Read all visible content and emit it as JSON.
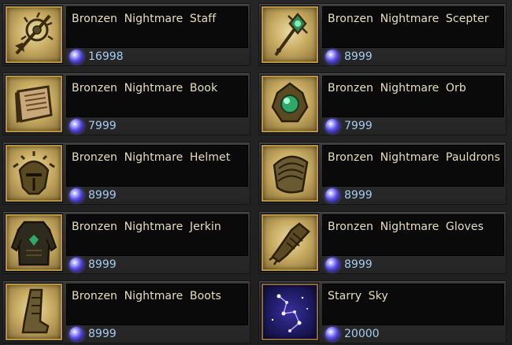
{
  "currency": {
    "icon": "purple-gem-icon",
    "color": "#5b50e0"
  },
  "colors": {
    "name_text": "#e7dfbf",
    "price_text": "#a6ccf2",
    "icon_frame": "#b8953a"
  },
  "items": [
    {
      "name": "Bronzen Nightmare Staff",
      "price": "16998",
      "icon": "staff-icon"
    },
    {
      "name": "Bronzen Nightmare Scepter",
      "price": "8999",
      "icon": "scepter-icon"
    },
    {
      "name": "Bronzen Nightmare Book",
      "price": "7999",
      "icon": "book-icon"
    },
    {
      "name": "Bronzen Nightmare Orb",
      "price": "7999",
      "icon": "orb-icon"
    },
    {
      "name": "Bronzen Nightmare Helmet",
      "price": "8999",
      "icon": "helmet-icon"
    },
    {
      "name": "Bronzen Nightmare Pauldrons",
      "price": "8999",
      "icon": "pauldrons-icon"
    },
    {
      "name": "Bronzen Nightmare Jerkin",
      "price": "8999",
      "icon": "jerkin-icon"
    },
    {
      "name": "Bronzen Nightmare Gloves",
      "price": "8999",
      "icon": "gloves-icon"
    },
    {
      "name": "Bronzen Nightmare Boots",
      "price": "8999",
      "icon": "boots-icon"
    },
    {
      "name": "Starry Sky",
      "price": "20000",
      "icon": "starry-sky-icon"
    }
  ]
}
